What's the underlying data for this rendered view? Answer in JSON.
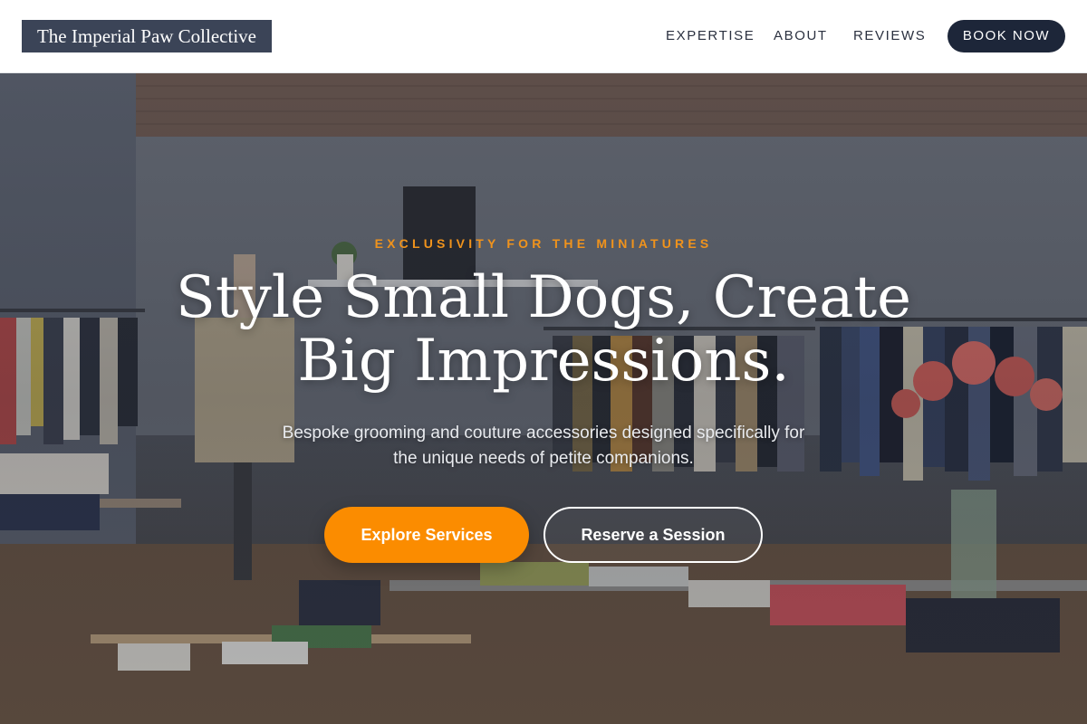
{
  "brand": {
    "name": "The Imperial Paw Collective"
  },
  "nav": {
    "links": [
      "EXPERTISE",
      "ABOUT",
      "REVIEWS"
    ],
    "cta": "BOOK NOW"
  },
  "hero": {
    "eyebrow": "EXCLUSIVITY FOR THE MINIATURES",
    "headline_line1": "Style Small Dogs, Create",
    "headline_line2": "Big Impressions.",
    "subtitle_line1": "Bespoke grooming and couture accessories designed specifically for",
    "subtitle_line2": "the unique needs of petite companions.",
    "primary_button": "Explore Services",
    "secondary_button": "Reserve a Session",
    "background_image": "boutique-interior-photo"
  },
  "colors": {
    "accent": "#fb8c00",
    "navy": "#1d2639",
    "logo_bg": "#3b4457"
  }
}
